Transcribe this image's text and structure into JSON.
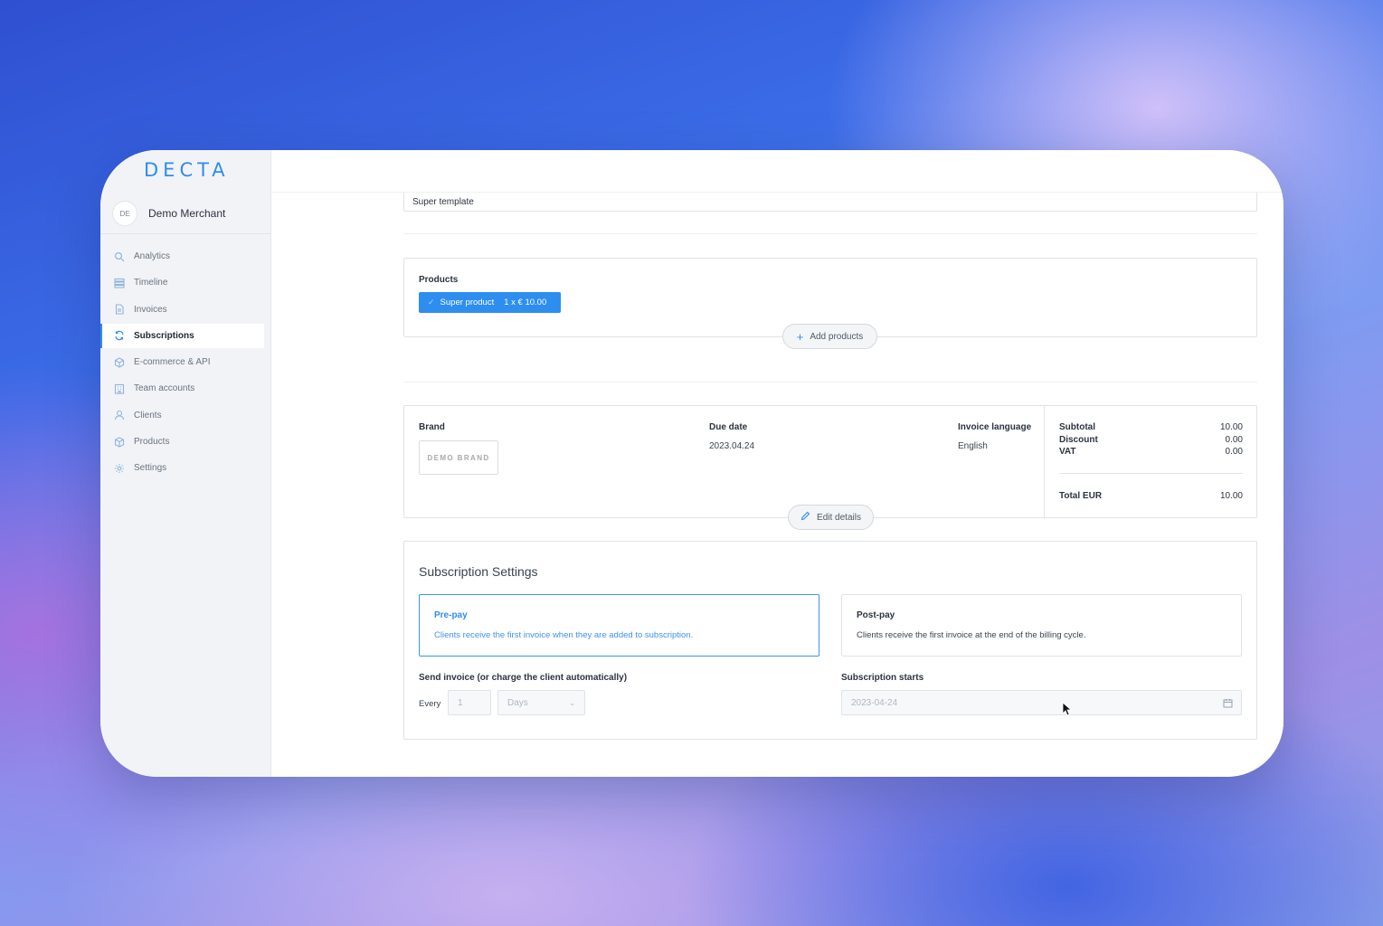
{
  "sidebar": {
    "logo": "DECTA",
    "merchant": {
      "initials": "DE",
      "name": "Demo Merchant"
    },
    "items": [
      {
        "label": "Analytics",
        "icon": "search-icon"
      },
      {
        "label": "Timeline",
        "icon": "timeline-icon"
      },
      {
        "label": "Invoices",
        "icon": "document-icon"
      },
      {
        "label": "Subscriptions",
        "icon": "refresh-icon",
        "active": true
      },
      {
        "label": "E-commerce & API",
        "icon": "cube-icon"
      },
      {
        "label": "Team accounts",
        "icon": "building-icon"
      },
      {
        "label": "Clients",
        "icon": "user-icon"
      },
      {
        "label": "Products",
        "icon": "box-icon"
      },
      {
        "label": "Settings",
        "icon": "gear-icon"
      }
    ]
  },
  "template": {
    "value": "Super template"
  },
  "products": {
    "label": "Products",
    "chip": {
      "name": "Super product",
      "qty_price": "1 x € 10.00"
    },
    "add_label": "Add products"
  },
  "details": {
    "brand_label": "Brand",
    "brand_logo": "DEMO BRAND",
    "due_label": "Due date",
    "due_value": "2023.04.24",
    "lang_label": "Invoice language",
    "lang_value": "English",
    "edit_label": "Edit details"
  },
  "totals": {
    "subtotal_label": "Subtotal",
    "subtotal": "10.00",
    "discount_label": "Discount",
    "discount": "0.00",
    "vat_label": "VAT",
    "vat": "0.00",
    "total_label": "Total EUR",
    "total": "10.00"
  },
  "subscription": {
    "title": "Subscription Settings",
    "prepay": {
      "title": "Pre-pay",
      "desc": "Clients receive the first invoice when they are added to subscription.",
      "selected": true
    },
    "postpay": {
      "title": "Post-pay",
      "desc": "Clients receive the first invoice at the end of the billing cycle.",
      "selected": false
    },
    "send_label": "Send invoice (or charge the client automatically)",
    "every_label": "Every",
    "every_value": "1",
    "period_value": "Days",
    "starts_label": "Subscription starts",
    "starts_value": "2023-04-24"
  },
  "colors": {
    "accent": "#2d8ef0",
    "sidebar_bg": "#f1f3f6",
    "border": "#dfe3e8"
  }
}
